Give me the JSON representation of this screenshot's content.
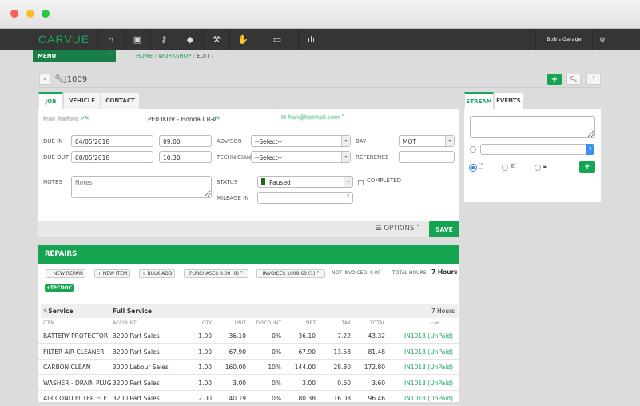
{
  "nav": {
    "logo": "CARVUE",
    "icons": [
      "home-icon",
      "address-book-icon",
      "key-icon",
      "box-icon",
      "wrench-icon",
      "handshake-icon",
      "money-icon",
      "chart-icon"
    ],
    "garage": "Bob's Garage"
  },
  "menu": {
    "label": "MENU"
  },
  "breadcrumb": [
    "HOME",
    "WORKSHOP",
    "EDIT"
  ],
  "job": {
    "title": "J1009"
  },
  "tabs": [
    "JOB",
    "VEHICLE",
    "CONTACT"
  ],
  "customer": {
    "name": "Fran Trafford",
    "vehicle": "PE03KUV - Honda CR-V",
    "email": "fran@hotmail.com"
  },
  "form": {
    "due_in_label": "DUE IN",
    "due_in_date": "04/05/2018",
    "due_in_time": "09:00",
    "due_out_label": "DUE OUT",
    "due_out_date": "08/05/2018",
    "due_out_time": "10:30",
    "advisor_label": "ADVISOR",
    "advisor_value": "--Select--",
    "technician_label": "TECHNICIAN",
    "technician_value": "--Select--",
    "bay_label": "BAY",
    "bay_value": "MOT",
    "reference_label": "REFERENCE",
    "reference_value": "",
    "notes_label": "NOTES",
    "notes_placeholder": "Notes",
    "status_label": "STATUS",
    "status_value": "Paused",
    "status_color": "#1e6b12",
    "completed_label": "COMPLETED",
    "mileage_label": "MILEAGE IN"
  },
  "footer": {
    "options": "OPTIONS",
    "save": "SAVE"
  },
  "stream": {
    "tabs": [
      "STREAM",
      "EVENTS"
    ]
  },
  "repairs": {
    "title": "REPAIRS",
    "buttons": [
      "+ NEW REPAIR",
      "+ NEW ITEM",
      "+ BULK ADD",
      "PURCHASES 0.00 (0)",
      "INVOICES 1009.60 (1)"
    ],
    "not_invoiced": "NOT INVOICED: 0.00",
    "total_hours_label": "TOTAL HOURS:",
    "total_hours": "7 Hours",
    "tecdoc": "+TECDOC",
    "group": {
      "name": "Service",
      "description": "Full Service",
      "hours": "7 Hours"
    },
    "columns": [
      "ITEM",
      "ACCOUNT",
      "QTY",
      "UNIT",
      "DISCOUNT",
      "NET",
      "TAX",
      "TOTAL"
    ],
    "rows": [
      [
        "BATTERY PROTECTOR",
        "3200 Part Sales",
        "1.00",
        "36.10",
        "0%",
        "36.10",
        "7.22",
        "43.32",
        "IN1018 (UnPaid)"
      ],
      [
        "FILTER AIR CLEANER",
        "3200 Part Sales",
        "1.00",
        "67.90",
        "0%",
        "67.90",
        "13.58",
        "81.48",
        "IN1018 (UnPaid)"
      ],
      [
        "CARBON CLEAN",
        "3000 Labour Sales",
        "1.00",
        "160.00",
        "10%",
        "144.00",
        "28.80",
        "172.80",
        "IN1018 (UnPaid)"
      ],
      [
        "WASHER - DRAIN PLUG",
        "3200 Part Sales",
        "1.00",
        "3.00",
        "0%",
        "3.00",
        "0.60",
        "3.60",
        "IN1018 (UnPaid)"
      ],
      [
        "AIR COND FILTER ELE...",
        "3200 Part Sales",
        "2.00",
        "40.19",
        "0%",
        "80.38",
        "16.08",
        "96.46",
        "IN1018 (UnPaid)"
      ]
    ]
  },
  "colors": {
    "accent": "#14a452",
    "nav": "#353535"
  }
}
